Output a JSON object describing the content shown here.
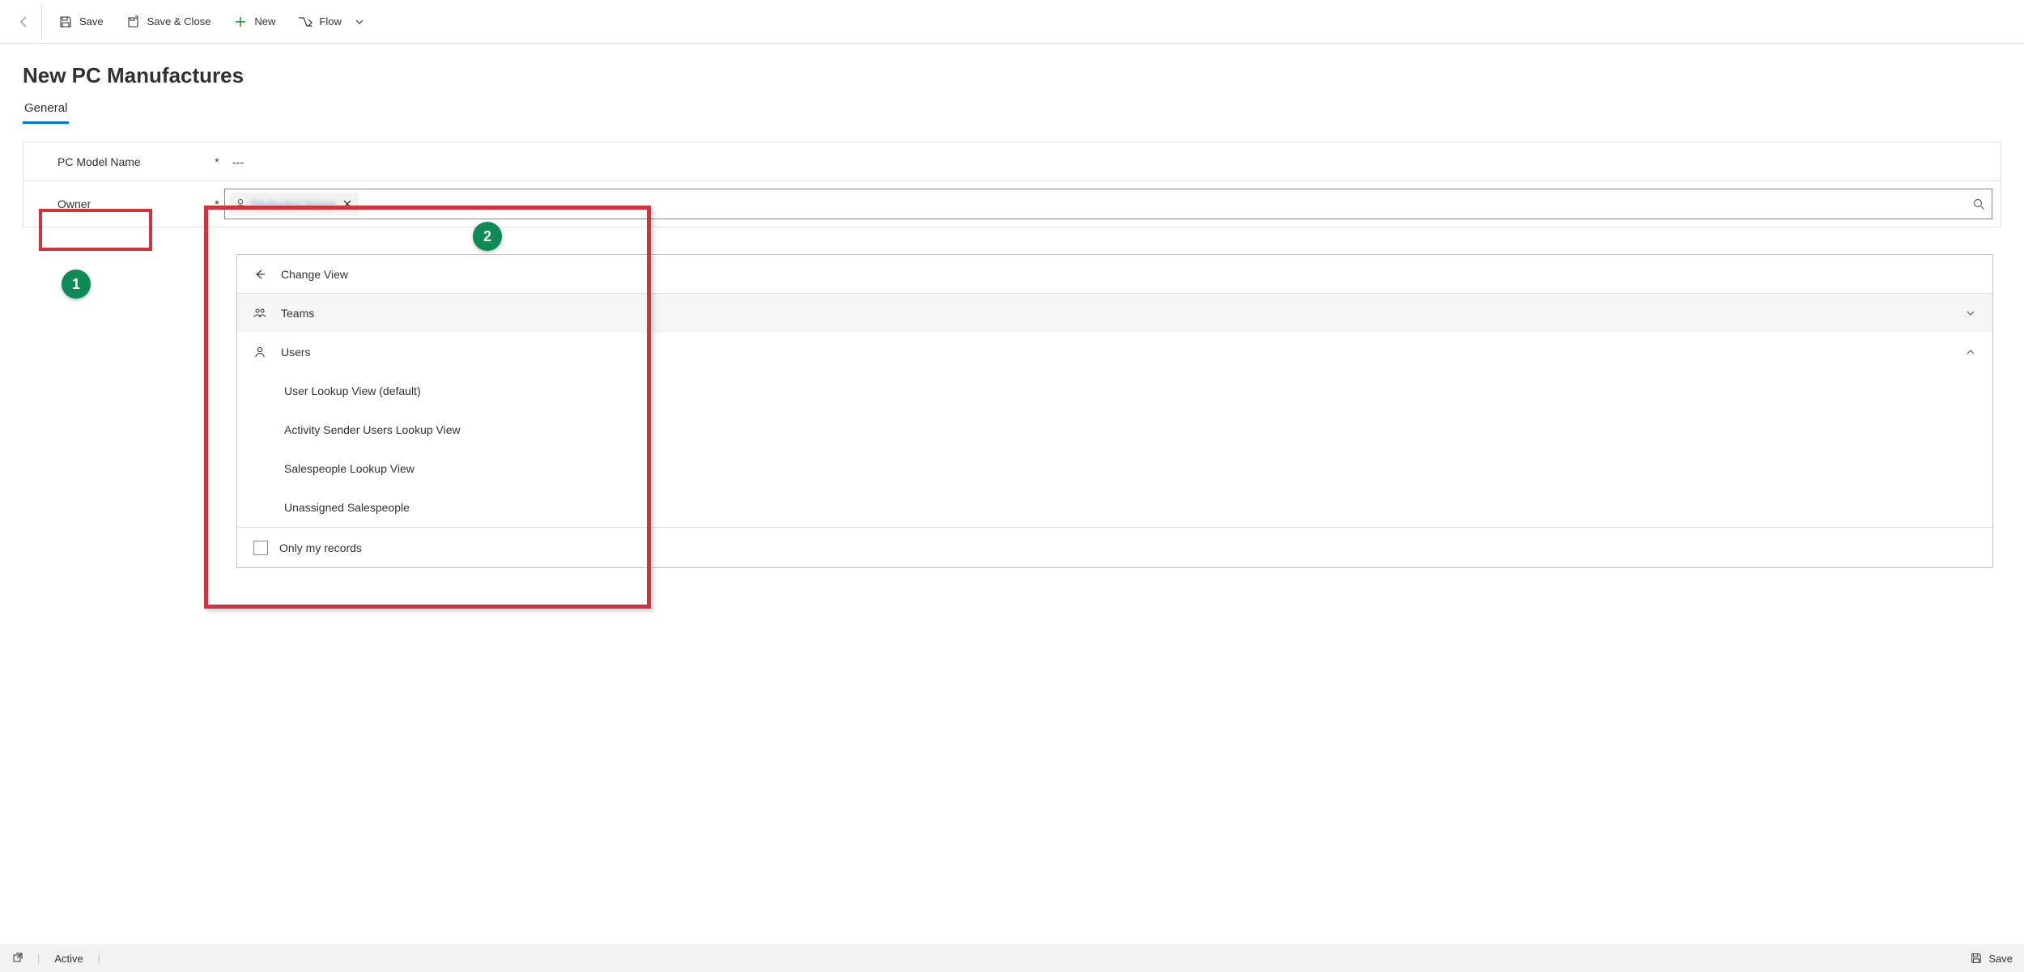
{
  "toolbar": {
    "save": "Save",
    "save_close": "Save & Close",
    "new": "New",
    "flow": "Flow"
  },
  "page_title": "New PC Manufactures",
  "tabs": {
    "general": "General"
  },
  "fields": {
    "pc_model": {
      "label": "PC Model Name",
      "value": "---"
    },
    "owner": {
      "label": "Owner",
      "chip_blurred": "Redacted Name"
    }
  },
  "lookup_dropdown": {
    "change_view": "Change View",
    "teams": "Teams",
    "users": "Users",
    "user_views": [
      "User Lookup View (default)",
      "Activity Sender Users Lookup View",
      "Salespeople Lookup View",
      "Unassigned Salespeople"
    ],
    "only_my_records": "Only my records"
  },
  "statusbar": {
    "status": "Active",
    "save": "Save"
  },
  "callouts": {
    "one": "1",
    "two": "2"
  }
}
